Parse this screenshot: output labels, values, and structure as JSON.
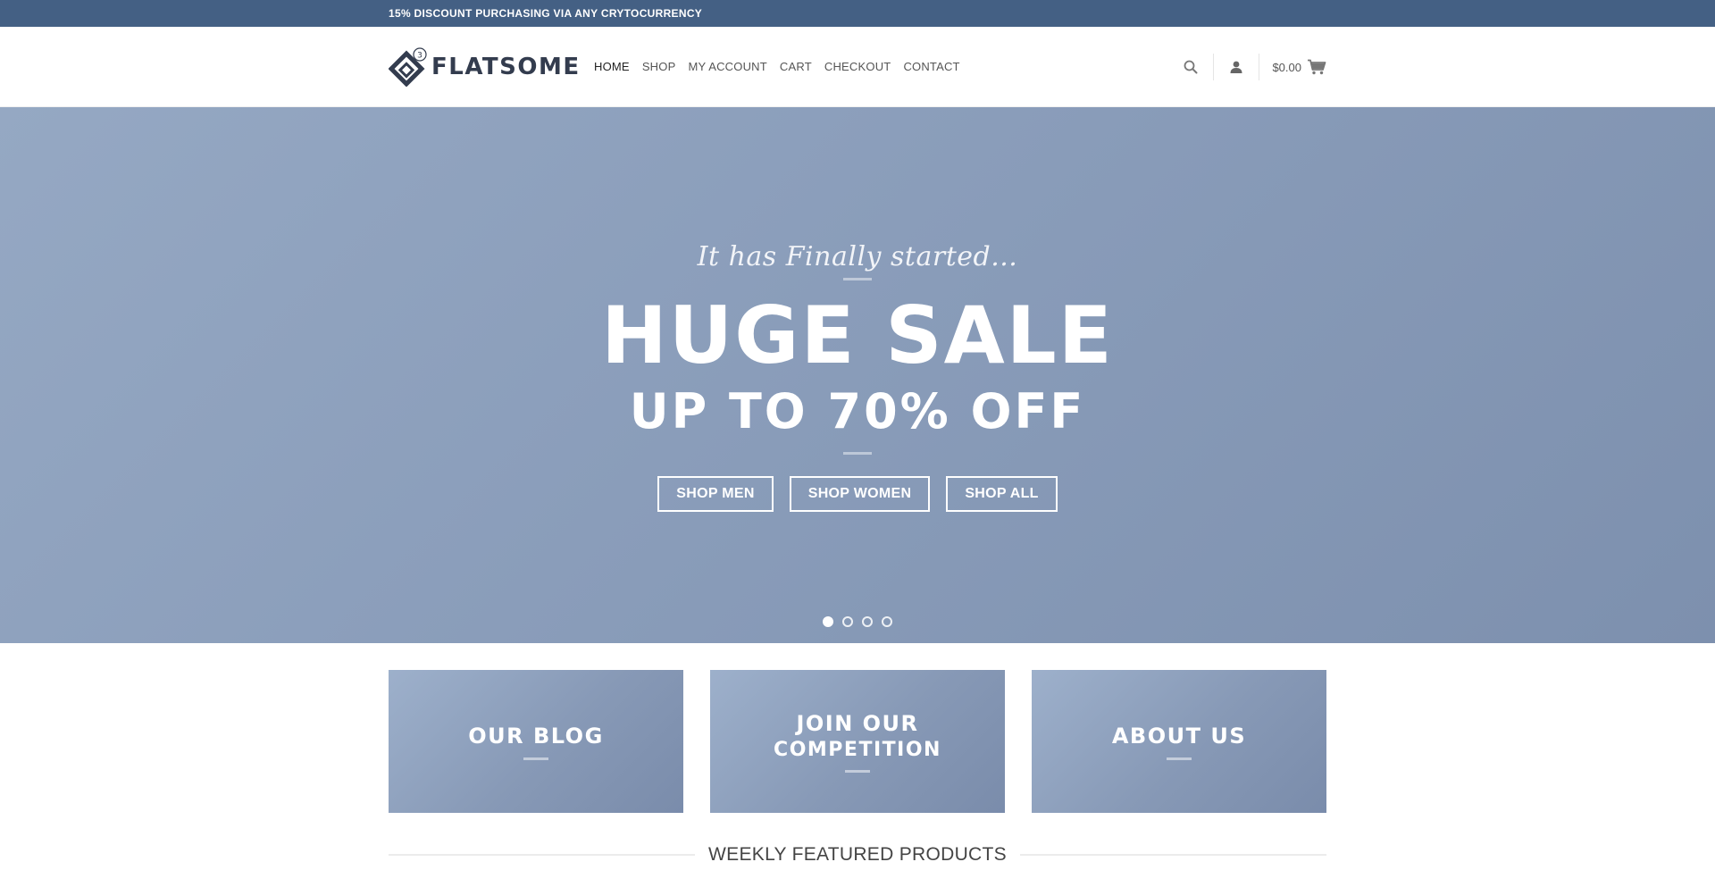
{
  "topbar": {
    "text": "15% DISCOUNT PURCHASING VIA ANY CRYTOCURRENCY"
  },
  "logo": {
    "text": "FLATSOME",
    "badge": "3"
  },
  "nav": {
    "items": [
      {
        "label": "HOME"
      },
      {
        "label": "SHOP"
      },
      {
        "label": "MY ACCOUNT"
      },
      {
        "label": "CART"
      },
      {
        "label": "CHECKOUT"
      },
      {
        "label": "CONTACT"
      }
    ]
  },
  "header": {
    "cart_total": "$0.00",
    "icons": [
      "search-icon",
      "user-icon",
      "cart-icon"
    ]
  },
  "hero": {
    "tagline": "It has Finally started...",
    "title": "HUGE SALE",
    "subtitle": "UP TO 70% OFF",
    "buttons": [
      {
        "label": "SHOP MEN"
      },
      {
        "label": "SHOP WOMEN"
      },
      {
        "label": "SHOP ALL"
      }
    ],
    "slides_total": 4,
    "active_slide": 1
  },
  "banners": [
    {
      "title": "OUR BLOG"
    },
    {
      "title_line1": "JOIN OUR",
      "title_line2": "COMPETITION"
    },
    {
      "title": "ABOUT US"
    }
  ],
  "featured": {
    "title": "WEEKLY FEATURED PRODUCTS"
  },
  "colors": {
    "topbar": "#446084",
    "hero": "#8b9ebb",
    "text_dark": "#333c4e"
  }
}
